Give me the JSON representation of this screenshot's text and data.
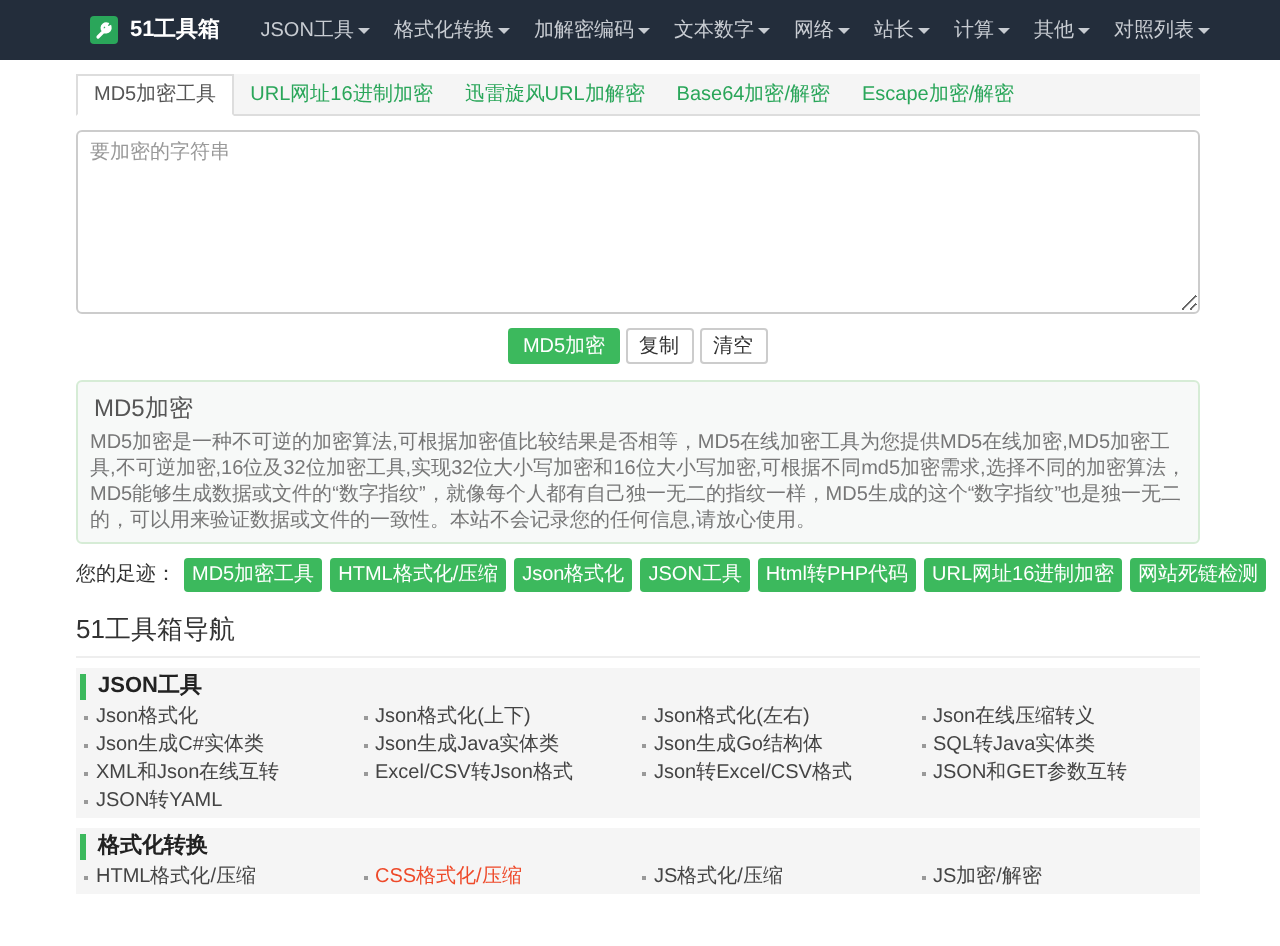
{
  "navbar": {
    "brand": "51工具箱",
    "menu": [
      {
        "label": "JSON工具"
      },
      {
        "label": "格式化转换"
      },
      {
        "label": "加解密编码"
      },
      {
        "label": "文本数字"
      },
      {
        "label": "网络"
      },
      {
        "label": "站长"
      },
      {
        "label": "计算"
      },
      {
        "label": "其他"
      },
      {
        "label": "对照列表"
      }
    ]
  },
  "tabs": [
    {
      "label": "MD5加密工具",
      "selected": true
    },
    {
      "label": "URL网址16进制加密",
      "selected": false
    },
    {
      "label": "迅雷旋风URL加解密",
      "selected": false
    },
    {
      "label": "Base64加密/解密",
      "selected": false
    },
    {
      "label": "Escape加密/解密",
      "selected": false
    }
  ],
  "input": {
    "placeholder": "要加密的字符串"
  },
  "buttons": [
    {
      "label": "MD5加密",
      "kind": "primary"
    },
    {
      "label": "复制",
      "kind": "default"
    },
    {
      "label": "清空",
      "kind": "default"
    }
  ],
  "info": {
    "title": "MD5加密",
    "text": "MD5加密是一种不可逆的加密算法,可根据加密值比较结果是否相等，MD5在线加密工具为您提供MD5在线加密,MD5加密工具,不可逆加密,16位及32位加密工具,实现32位大小写加密和16位大小写加密,可根据不同md5加密需求,选择不同的加密算法，MD5能够生成数据或文件的“数字指纹”，就像每个人都有自己独一无二的指纹一样，MD5生成的这个“数字指纹”也是独一无二的，可以用来验证数据或文件的一致性。本站不会记录您的任何信息,请放心使用。"
  },
  "history": {
    "label": "您的足迹：",
    "items": [
      "MD5加密工具",
      "HTML格式化/压缩",
      "Json格式化",
      "JSON工具",
      "Html转PHP代码",
      "URL网址16进制加密",
      "网站死链检测"
    ]
  },
  "nav_title": "51工具箱导航",
  "sections": [
    {
      "title": "JSON工具",
      "links": [
        {
          "label": "Json格式化",
          "highlighted": false
        },
        {
          "label": "Json格式化(上下)",
          "highlighted": false
        },
        {
          "label": "Json格式化(左右)",
          "highlighted": false
        },
        {
          "label": "Json在线压缩转义",
          "highlighted": false
        },
        {
          "label": "Json生成C#实体类",
          "highlighted": false
        },
        {
          "label": "Json生成Java实体类",
          "highlighted": false
        },
        {
          "label": "Json生成Go结构体",
          "highlighted": false
        },
        {
          "label": "SQL转Java实体类",
          "highlighted": false
        },
        {
          "label": "XML和Json在线互转",
          "highlighted": false
        },
        {
          "label": "Excel/CSV转Json格式",
          "highlighted": false
        },
        {
          "label": "Json转Excel/CSV格式",
          "highlighted": false
        },
        {
          "label": "JSON和GET参数互转",
          "highlighted": false
        },
        {
          "label": "JSON转YAML",
          "highlighted": false
        }
      ]
    },
    {
      "title": "格式化转换",
      "links": [
        {
          "label": "HTML格式化/压缩",
          "highlighted": false
        },
        {
          "label": "CSS格式化/压缩",
          "highlighted": true
        },
        {
          "label": "JS格式化/压缩",
          "highlighted": false
        },
        {
          "label": "JS加密/解密",
          "highlighted": false
        }
      ]
    }
  ]
}
